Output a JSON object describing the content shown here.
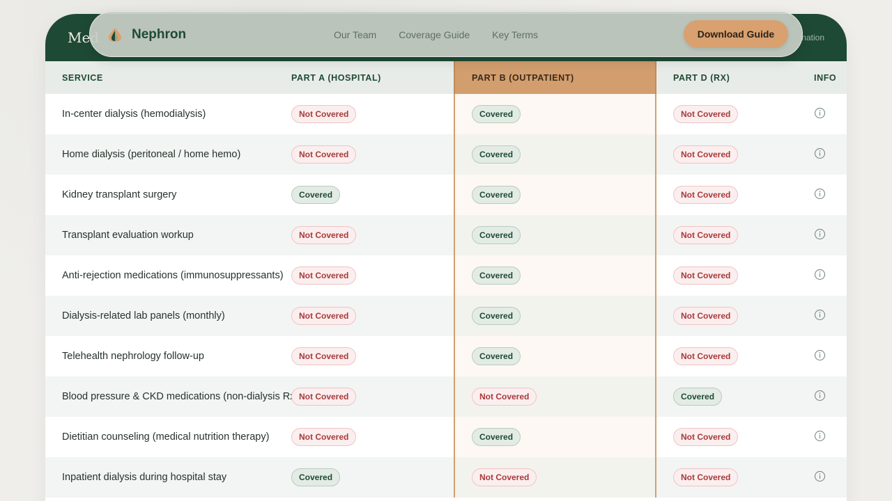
{
  "nav": {
    "brand": "Nephron",
    "links": [
      "Our Team",
      "Coverage Guide",
      "Key Terms"
    ],
    "cta": "Download Guide"
  },
  "card": {
    "title": "Med",
    "subtitle": "nation"
  },
  "table": {
    "headers": [
      "SERVICE",
      "PART A (HOSPITAL)",
      "PART B (OUTPATIENT)",
      "PART D (RX)",
      "INFO"
    ],
    "rows": [
      {
        "service": "In-center dialysis (hemodialysis)",
        "a": "Not Covered",
        "b": "Covered",
        "d": "Not Covered"
      },
      {
        "service": "Home dialysis (peritoneal / home hemo)",
        "a": "Not Covered",
        "b": "Covered",
        "d": "Not Covered"
      },
      {
        "service": "Kidney transplant surgery",
        "a": "Covered",
        "b": "Covered",
        "d": "Not Covered"
      },
      {
        "service": "Transplant evaluation workup",
        "a": "Not Covered",
        "b": "Covered",
        "d": "Not Covered"
      },
      {
        "service": "Anti-rejection medications (immunosuppressants)",
        "a": "Not Covered",
        "b": "Covered",
        "d": "Not Covered"
      },
      {
        "service": "Dialysis-related lab panels (monthly)",
        "a": "Not Covered",
        "b": "Covered",
        "d": "Not Covered"
      },
      {
        "service": "Telehealth nephrology follow-up",
        "a": "Not Covered",
        "b": "Covered",
        "d": "Not Covered"
      },
      {
        "service": "Blood pressure & CKD medications (non-dialysis Rx)",
        "a": "Not Covered",
        "b": "Not Covered",
        "d": "Covered"
      },
      {
        "service": "Dietitian counseling (medical nutrition therapy)",
        "a": "Not Covered",
        "b": "Covered",
        "d": "Not Covered"
      },
      {
        "service": "Inpatient dialysis during hospital stay",
        "a": "Covered",
        "b": "Not Covered",
        "d": "Not Covered"
      }
    ]
  },
  "colors": {
    "brand_green": "#1e4a35",
    "accent_orange": "#d29e6e",
    "covered": "#1e4a35",
    "not_covered": "#a8393a"
  },
  "icons": {
    "logo": "leaf-drop-logo",
    "info": "info-icon"
  }
}
